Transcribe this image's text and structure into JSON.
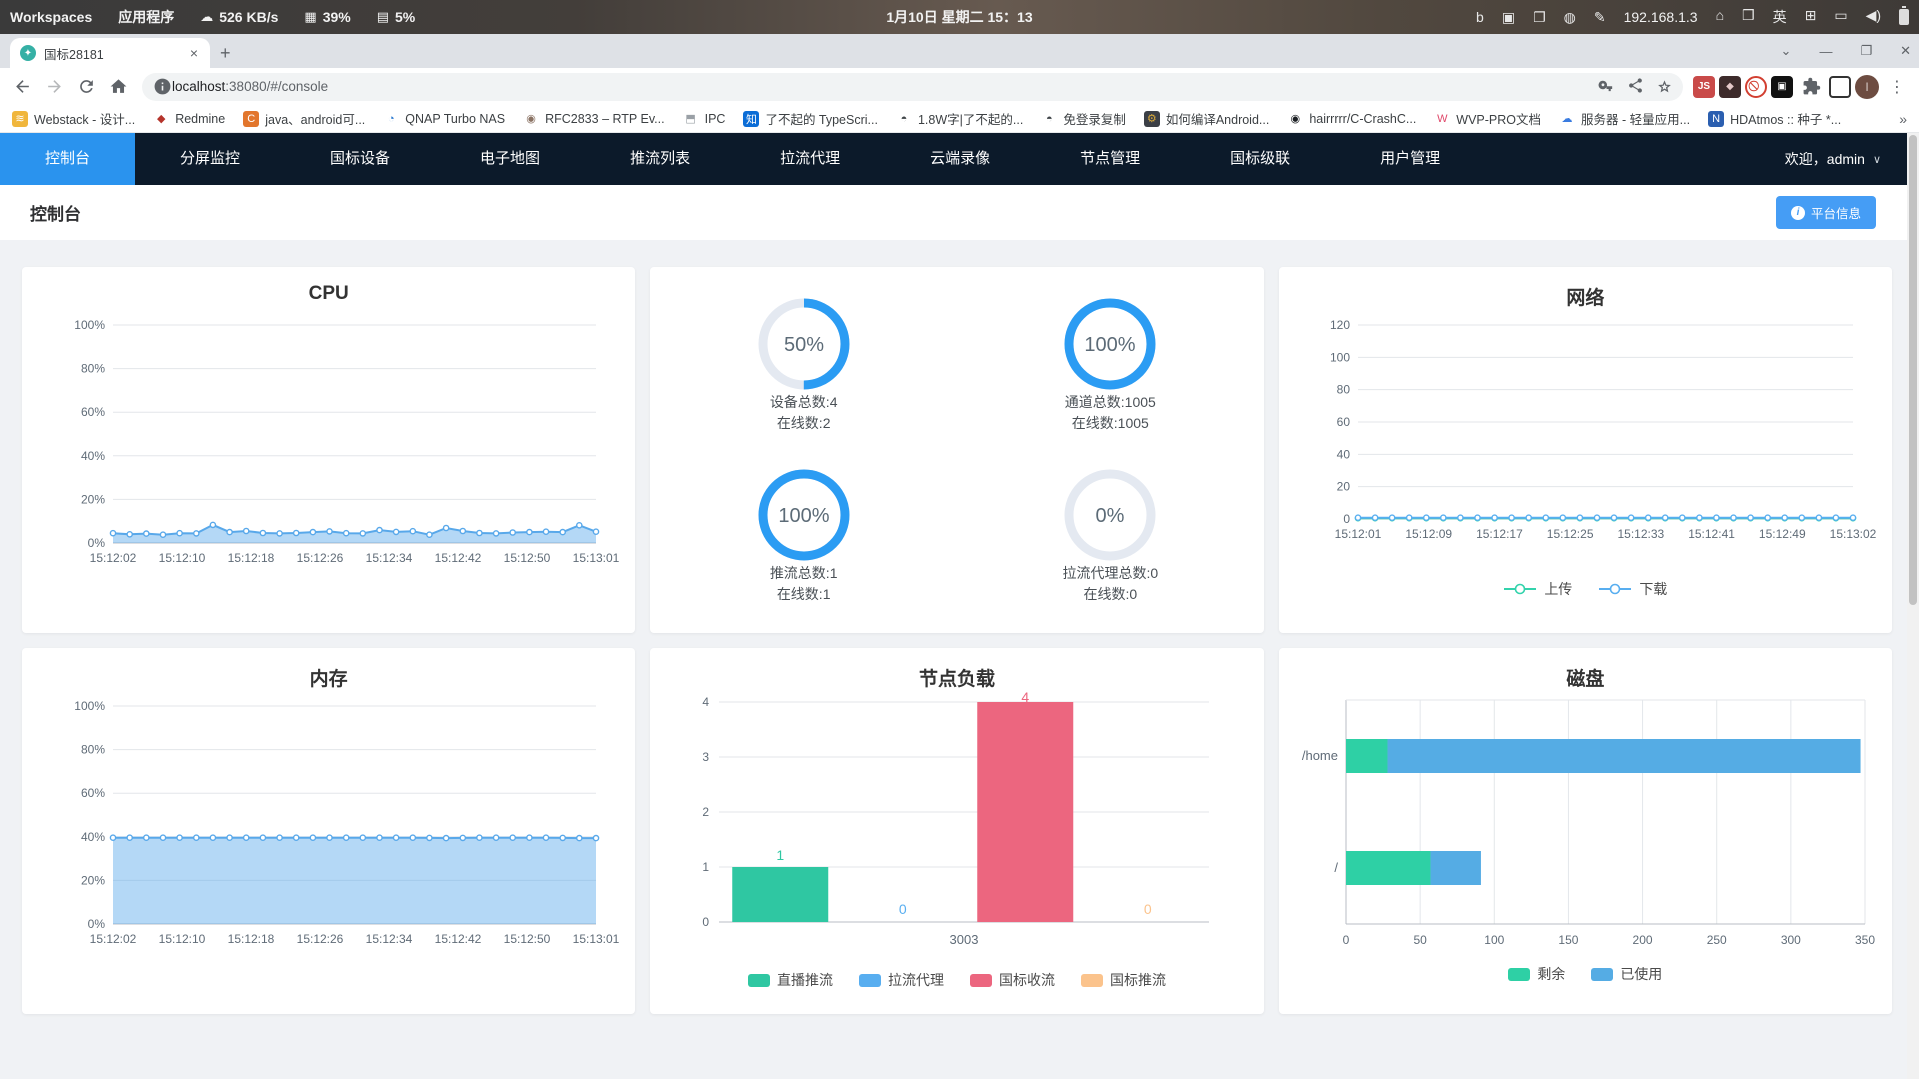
{
  "system_bar": {
    "workspaces": "Workspaces",
    "applications": "应用程序",
    "net_speed": "526 KB/s",
    "cpu": "39%",
    "mem": "5%",
    "clock": "1月10日 星期二 15：13",
    "ip": "192.168.1.3",
    "tray_icons": [
      {
        "name": "search-b-icon",
        "glyph": "b"
      },
      {
        "name": "screenshot-tool-icon",
        "glyph": "▣"
      },
      {
        "name": "clipboard-icon",
        "glyph": "❐"
      },
      {
        "name": "app-indicator-icon",
        "glyph": "◍"
      },
      {
        "name": "color-picker-icon",
        "glyph": "✎"
      }
    ],
    "tray_icons2": [
      {
        "name": "home-icon",
        "glyph": "⌂"
      },
      {
        "name": "workspace-switcher-icon",
        "glyph": "❒"
      },
      {
        "name": "input-method-icon",
        "glyph": "英"
      },
      {
        "name": "keyboard-panel-icon",
        "glyph": "⊞"
      },
      {
        "name": "display-icon",
        "glyph": "▭"
      },
      {
        "name": "volume-icon",
        "glyph": "◀)"
      }
    ]
  },
  "browser": {
    "tab_title": "国标28181",
    "close_tab": "×",
    "new_tab": "+",
    "window_controls": [
      "⌄",
      "—",
      "❐",
      "✕"
    ],
    "url_host": "localhost",
    "url_rest": ":38080/#/console",
    "bookmarks": [
      {
        "label": "Webstack - 设计...",
        "glyph": "≋",
        "bg": "#f0b63c",
        "fg": "#fff"
      },
      {
        "label": "Redmine",
        "glyph": "◆",
        "bg": "none",
        "fg": "#b5342b"
      },
      {
        "label": "java、android可...",
        "glyph": "C",
        "bg": "#e2762d",
        "fg": "#fff"
      },
      {
        "label": "QNAP Turbo NAS",
        "glyph": "◔",
        "bg": "none",
        "fg": "#2e7bd1"
      },
      {
        "label": "RFC2833 – RTP Ev...",
        "glyph": "◉",
        "bg": "none",
        "fg": "#8a7263"
      },
      {
        "label": "IPC",
        "glyph": "⬒",
        "bg": "none",
        "fg": "#9aa0a6"
      },
      {
        "label": "了不起的 TypeScri...",
        "glyph": "知",
        "bg": "#0c6dd6",
        "fg": "#fff"
      },
      {
        "label": "1.8W字|了不起的...",
        "glyph": "◓",
        "bg": "none",
        "fg": "#3e4347"
      },
      {
        "label": "免登录复制",
        "glyph": "◓",
        "bg": "none",
        "fg": "#3e4347"
      },
      {
        "label": "如何编译Android...",
        "glyph": "⚙",
        "bg": "#3b3f46",
        "fg": "#d8a93c"
      },
      {
        "label": "hairrrrr/C-CrashC...",
        "glyph": "◉",
        "bg": "none",
        "fg": "#1b1f23"
      },
      {
        "label": "WVP-PRO文档",
        "glyph": "W",
        "bg": "none",
        "fg": "#e0486a"
      },
      {
        "label": "服务器 - 轻量应用...",
        "glyph": "☁",
        "bg": "none",
        "fg": "#3a7ce0"
      },
      {
        "label": "HDAtmos :: 种子 *...",
        "glyph": "N",
        "bg": "#2b5fb0",
        "fg": "#fff"
      }
    ],
    "bookmarks_overflow": "»"
  },
  "nav": {
    "items": [
      {
        "label": "控制台",
        "active": true
      },
      {
        "label": "分屏监控",
        "active": false
      },
      {
        "label": "国标设备",
        "active": false
      },
      {
        "label": "电子地图",
        "active": false
      },
      {
        "label": "推流列表",
        "active": false
      },
      {
        "label": "拉流代理",
        "active": false
      },
      {
        "label": "云端录像",
        "active": false
      },
      {
        "label": "节点管理",
        "active": false
      },
      {
        "label": "国标级联",
        "active": false
      },
      {
        "label": "用户管理",
        "active": false
      }
    ],
    "welcome": "欢迎，admin"
  },
  "header": {
    "title": "控制台",
    "platform_info": "平台信息"
  },
  "colors": {
    "accent": "#2b9cf3",
    "ring_track": "#e4e9f1"
  },
  "stats": {
    "rings": [
      {
        "percent": "50%",
        "pct": 50,
        "line1": "设备总数:4",
        "line2": "在线数:2"
      },
      {
        "percent": "100%",
        "pct": 100,
        "line1": "通道总数:1005",
        "line2": "在线数:1005"
      },
      {
        "percent": "100%",
        "pct": 100,
        "line1": "推流总数:1",
        "line2": "在线数:1"
      },
      {
        "percent": "0%",
        "pct": 0,
        "line1": "拉流代理总数:0",
        "line2": "在线数:0"
      }
    ]
  },
  "chart_data": {
    "cpu": {
      "type": "area",
      "title": "CPU",
      "y_max": 100,
      "y_ticks": [
        {
          "v": 0,
          "label": "0%"
        },
        {
          "v": 20,
          "label": "20%"
        },
        {
          "v": 40,
          "label": "40%"
        },
        {
          "v": 60,
          "label": "60%"
        },
        {
          "v": 80,
          "label": "80%"
        },
        {
          "v": 100,
          "label": "100%"
        }
      ],
      "x_labels": [
        "15:12:02",
        "15:12:10",
        "15:12:18",
        "15:12:26",
        "15:12:34",
        "15:12:42",
        "15:12:50",
        "15:13:01"
      ],
      "series": [
        {
          "name": "CPU",
          "color": "#58a8ea",
          "fill": "rgba(88,168,234,0.45)",
          "values": [
            4.5,
            4.0,
            4.3,
            3.8,
            4.5,
            4.4,
            8.3,
            5.0,
            5.5,
            4.6,
            4.4,
            4.6,
            5.0,
            5.3,
            4.5,
            4.4,
            5.9,
            5.1,
            5.4,
            3.8,
            6.9,
            5.5,
            4.6,
            4.4,
            4.8,
            5.0,
            5.2,
            5.0,
            8.1,
            5.2
          ]
        }
      ]
    },
    "network": {
      "type": "line",
      "title": "网络",
      "y_max": 120,
      "y_ticks": [
        {
          "v": 0,
          "label": "0"
        },
        {
          "v": 20,
          "label": "20"
        },
        {
          "v": 40,
          "label": "40"
        },
        {
          "v": 60,
          "label": "60"
        },
        {
          "v": 80,
          "label": "80"
        },
        {
          "v": 100,
          "label": "100"
        },
        {
          "v": 120,
          "label": "120"
        }
      ],
      "x_labels": [
        "15:12:01",
        "15:12:09",
        "15:12:17",
        "15:12:25",
        "15:12:33",
        "15:12:41",
        "15:12:49",
        "15:13:02"
      ],
      "series": [
        {
          "name": "上传",
          "color": "#33d3ac",
          "fill": null,
          "values": [
            0.5,
            0.5,
            0.5,
            0.5,
            0.5,
            0.5,
            0.5,
            0.5,
            0.5,
            0.5,
            0.5,
            0.5,
            0.5,
            0.5,
            0.5,
            0.5,
            0.5,
            0.5,
            0.5,
            0.5,
            0.5,
            0.5,
            0.5,
            0.5,
            0.5,
            0.5,
            0.5,
            0.5,
            0.5,
            0.5
          ]
        },
        {
          "name": "下载",
          "color": "#58aef0",
          "fill": null,
          "values": [
            0.8,
            0.8,
            0.8,
            0.8,
            0.8,
            0.8,
            0.8,
            0.8,
            0.8,
            0.8,
            0.8,
            0.8,
            0.8,
            0.8,
            0.8,
            0.8,
            0.8,
            0.8,
            0.8,
            0.8,
            0.8,
            0.8,
            0.8,
            0.8,
            0.8,
            0.8,
            0.8,
            0.8,
            0.8,
            0.8
          ]
        }
      ],
      "legend": [
        {
          "label": "上传",
          "color": "#33d3ac"
        },
        {
          "label": "下载",
          "color": "#58aef0"
        }
      ]
    },
    "memory": {
      "type": "area",
      "title": "内存",
      "y_max": 100,
      "y_ticks": [
        {
          "v": 0,
          "label": "0%"
        },
        {
          "v": 20,
          "label": "20%"
        },
        {
          "v": 40,
          "label": "40%"
        },
        {
          "v": 60,
          "label": "60%"
        },
        {
          "v": 80,
          "label": "80%"
        },
        {
          "v": 100,
          "label": "100%"
        }
      ],
      "x_labels": [
        "15:12:02",
        "15:12:10",
        "15:12:18",
        "15:12:26",
        "15:12:34",
        "15:12:42",
        "15:12:50",
        "15:13:01"
      ],
      "series": [
        {
          "name": "内存",
          "color": "#58a8ea",
          "fill": "rgba(88,168,234,0.45)",
          "values": [
            39.6,
            39.6,
            39.6,
            39.6,
            39.6,
            39.6,
            39.6,
            39.6,
            39.6,
            39.6,
            39.6,
            39.6,
            39.6,
            39.6,
            39.6,
            39.6,
            39.6,
            39.6,
            39.6,
            39.5,
            39.4,
            39.5,
            39.6,
            39.6,
            39.6,
            39.6,
            39.6,
            39.5,
            39.4,
            39.4
          ]
        }
      ]
    },
    "node_load": {
      "type": "bar",
      "title": "节点负载",
      "category": "3003",
      "y_max": 4,
      "y_ticks": [
        0,
        1,
        2,
        3,
        4
      ],
      "series": [
        {
          "name": "直播推流",
          "color": "#2fc7a2",
          "value": 1
        },
        {
          "name": "拉流代理",
          "color": "#58aef0",
          "value": 0
        },
        {
          "name": "国标收流",
          "color": "#ec667f",
          "value": 4
        },
        {
          "name": "国标推流",
          "color": "#fbc38c",
          "value": 0
        }
      ]
    },
    "disk": {
      "type": "stacked-hbar",
      "title": "磁盘",
      "categories": [
        "/home",
        "/"
      ],
      "x_max": 350,
      "x_ticks": [
        0,
        50,
        100,
        150,
        200,
        250,
        300,
        350
      ],
      "series": [
        {
          "name": "剩余",
          "color": "#2ed0a5",
          "values": [
            28,
            57
          ]
        },
        {
          "name": "已使用",
          "color": "#55ace4",
          "values": [
            319,
            34
          ]
        }
      ]
    }
  }
}
